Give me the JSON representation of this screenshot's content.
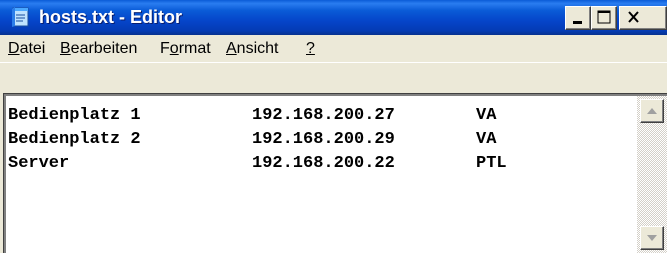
{
  "window": {
    "title": "hosts.txt - Editor",
    "minimize_icon": "minimize-icon",
    "maximize_icon": "maximize-icon",
    "close_icon": "close-icon",
    "app_icon": "notepad-icon"
  },
  "menu": {
    "items": [
      {
        "label": "Datei",
        "access_key": "D"
      },
      {
        "label": "Bearbeiten",
        "access_key": "B"
      },
      {
        "label": "Format",
        "access_key": "o"
      },
      {
        "label": "Ansicht",
        "access_key": "A"
      },
      {
        "label": "?",
        "access_key": "?"
      }
    ]
  },
  "editor": {
    "lines": [
      {
        "name": "Bedienplatz 1",
        "ip": "192.168.200.27",
        "tag": "VA"
      },
      {
        "name": "Bedienplatz 2",
        "ip": "192.168.200.29",
        "tag": "VA"
      },
      {
        "name": "Server",
        "ip": "192.168.200.22",
        "tag": "PTL"
      }
    ]
  },
  "scrollbar": {
    "up_icon": "scroll-up-arrow-icon",
    "down_icon": "scroll-down-arrow-icon"
  },
  "colors": {
    "titlebar": "#0545c9",
    "chrome": "#ece9d8",
    "text": "#000000",
    "editor_bg": "#ffffff"
  }
}
